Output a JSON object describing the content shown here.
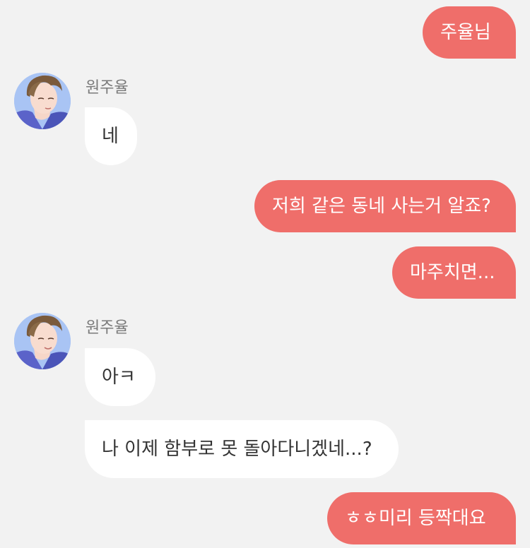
{
  "contact": {
    "name": "원주율"
  },
  "messages": [
    {
      "from": "me",
      "text": "주율님"
    },
    {
      "from": "other",
      "sender": "원주율",
      "text": "네"
    },
    {
      "from": "me",
      "text": "저희 같은 동네 사는거 알죠?"
    },
    {
      "from": "me",
      "text": "마주치면..."
    },
    {
      "from": "other",
      "sender": "원주율",
      "text": "아ㅋ"
    },
    {
      "from": "other",
      "text": "나 이제 함부로 못 돌아다니겠네...?"
    },
    {
      "from": "me",
      "text": "ㅎㅎ미리 등짝대요"
    }
  ],
  "avatar_icon": "illustrated-man-avatar",
  "colors": {
    "background": "#f2f2f2",
    "outgoing_bubble": "#ef6e6a",
    "incoming_bubble": "#ffffff",
    "avatar_background": "#a9c4f4"
  }
}
